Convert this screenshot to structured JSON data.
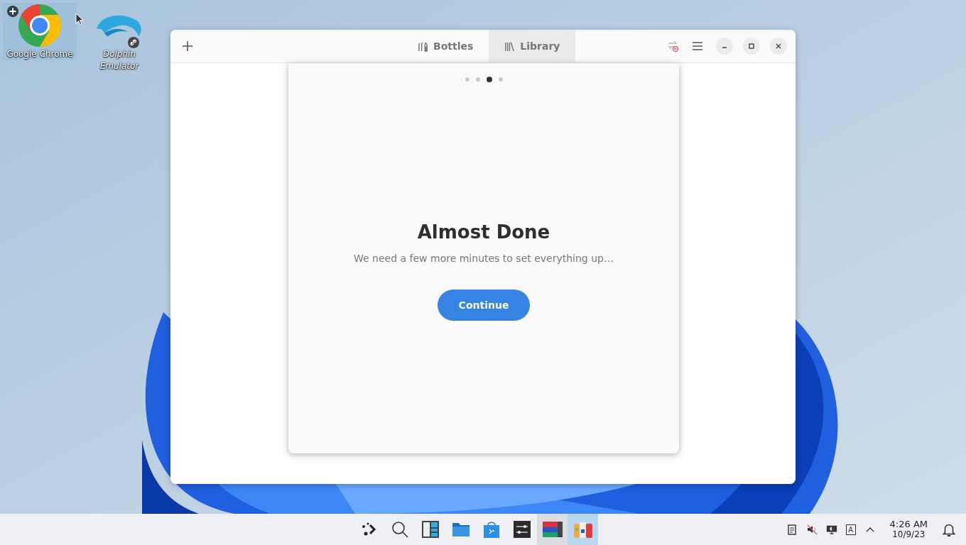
{
  "desktop_icons": [
    {
      "kind": "chrome",
      "label": "Google Chrome",
      "selected": true,
      "shortcut": false
    },
    {
      "kind": "dolphin",
      "label": "Dolphin Emulator",
      "selected": false,
      "shortcut": true
    }
  ],
  "window": {
    "tabs": [
      {
        "kind": "bottles",
        "label": "Bottles",
        "selected": false
      },
      {
        "kind": "library",
        "label": "Library",
        "selected": true
      }
    ]
  },
  "dialog": {
    "pages": [
      {
        "selected": false
      },
      {
        "selected": false
      },
      {
        "selected": true
      },
      {
        "selected": false
      }
    ],
    "title": "Almost Done",
    "message": "We need a few more minutes to set everything up…",
    "button": "Continue"
  },
  "taskbar": {
    "apps": [
      {
        "kind": "launcher",
        "selected": false,
        "running": false
      },
      {
        "kind": "search",
        "selected": false,
        "running": false
      },
      {
        "kind": "overview",
        "selected": false,
        "running": false
      },
      {
        "kind": "files",
        "selected": false,
        "running": false
      },
      {
        "kind": "store",
        "selected": false,
        "running": false
      },
      {
        "kind": "settings",
        "selected": false,
        "running": false
      },
      {
        "kind": "window",
        "selected": false,
        "running": true
      },
      {
        "kind": "bottles",
        "selected": true,
        "running": true
      }
    ],
    "input_method": "A",
    "time": "4:26 AM",
    "date": "10/9/23"
  }
}
